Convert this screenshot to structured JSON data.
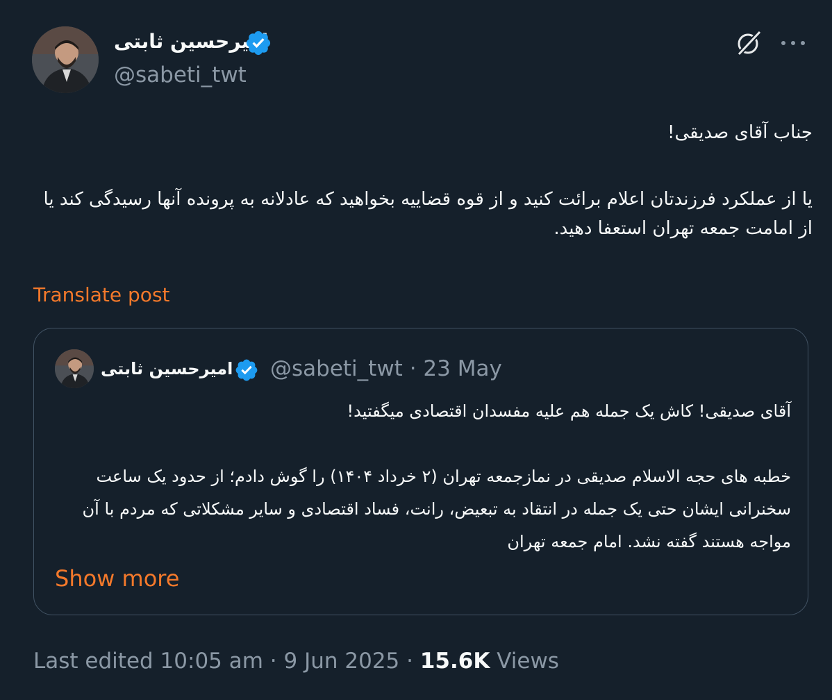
{
  "author": {
    "name": "امیرحسین ثابتی",
    "handle": "@sabeti_twt",
    "verified": true
  },
  "post": {
    "lines": [
      "جناب آقای صدیقی!",
      "یا از عملکرد فرزندتان اعلام برائت کنید و از قوه قضاییه بخواهید که عادلانه به پرونده آنها رسیدگی کند یا از امامت جمعه تهران استعفا دهید."
    ],
    "translate_label": "Translate post"
  },
  "quote": {
    "author_name": "امیرحسین ثابتی",
    "handle": "@sabeti_twt",
    "separator": "·",
    "date": "23 May",
    "lines": [
      "آقای صدیقی! کاش یک جمله هم علیه مفسدان اقتصادی میگفتید!",
      "خطبه های حجه الاسلام صدیقی در نمازجمعه تهران (۲ خرداد ۱۴۰۴) را گوش دادم؛ از حدود یک ساعت سخنرانی ایشان حتی یک جمله در انتقاد به تبعیض، رانت، فساد اقتصادی و سایر مشکلاتی که مردم با آن مواجه هستند گفته نشد. امام جمعه تهران"
    ],
    "show_more_label": "Show more"
  },
  "footer": {
    "edited_label": "Last edited 10:05 am",
    "separator": "·",
    "date": "9 Jun 2025",
    "views_count": "15.6K",
    "views_label": "Views"
  },
  "colors": {
    "background": "#15202b",
    "text": "#f7f9f9",
    "muted": "#8b98a5",
    "accent": "#f4792b",
    "verified": "#1d9bf0",
    "border": "#425364"
  },
  "icons": {
    "verified": "verified-badge-icon",
    "grok": "grok-icon",
    "more": "more-dots-icon"
  }
}
